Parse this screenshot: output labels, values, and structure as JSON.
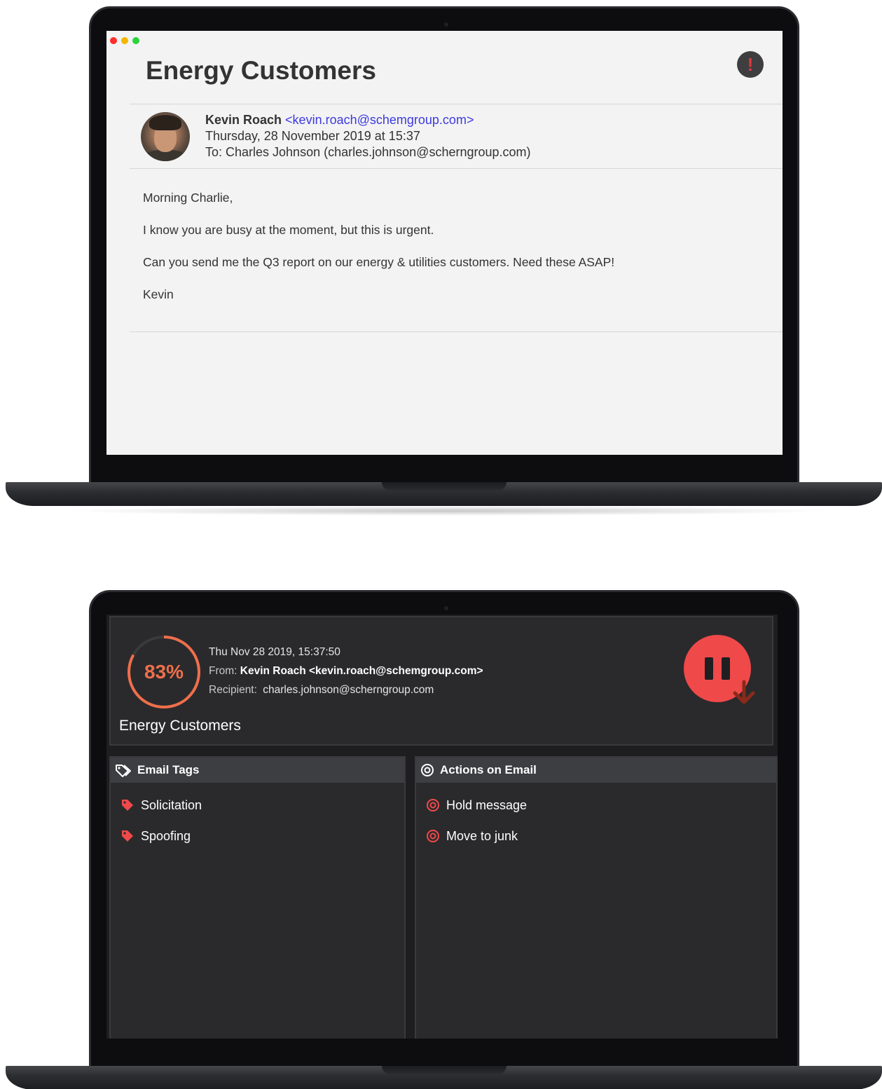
{
  "email": {
    "subject": "Energy Customers",
    "sender_name": "Kevin Roach",
    "sender_address": "<kevin.roach@schemgroup.com>",
    "date": "Thursday, 28 November 2019 at 15:37",
    "to": "To: Charles Johnson (charles.johnson@scherngroup.com)",
    "body": [
      "Morning Charlie,",
      "I know you are busy at the moment, but this is urgent.",
      "Can you send me the Q3 report on our energy & utilities customers. Need these ASAP!",
      "Kevin"
    ],
    "alert_glyph": "!"
  },
  "analysis": {
    "risk_score": "83%",
    "risk_fraction": 0.83,
    "timestamp": "Thu Nov 28 2019, 15:37:50",
    "from_label": "From:",
    "from_value": "Kevin Roach <kevin.roach@schemgroup.com>",
    "recipient_label": "Recipient:",
    "recipient_value": "charles.johnson@scherngroup.com",
    "subject": "Energy Customers",
    "tags_title": "Email Tags",
    "tags": [
      "Solicitation",
      "Spoofing"
    ],
    "actions_title": "Actions on Email",
    "actions": [
      "Hold message",
      "Move to junk"
    ]
  },
  "colors": {
    "close": "#ff2d2d",
    "minimize": "#f5b400",
    "maximize": "#2ad43a",
    "accent_red": "#f0494a",
    "gauge_orange": "#ef6f4b",
    "link_blue": "#3d3adf"
  },
  "icons": {
    "alert": "exclamation-circle-icon",
    "tags": "tags-icon",
    "tag": "tag-icon",
    "actions": "target-icon",
    "pause": "pause-icon",
    "arrow": "arrow-down-icon"
  }
}
